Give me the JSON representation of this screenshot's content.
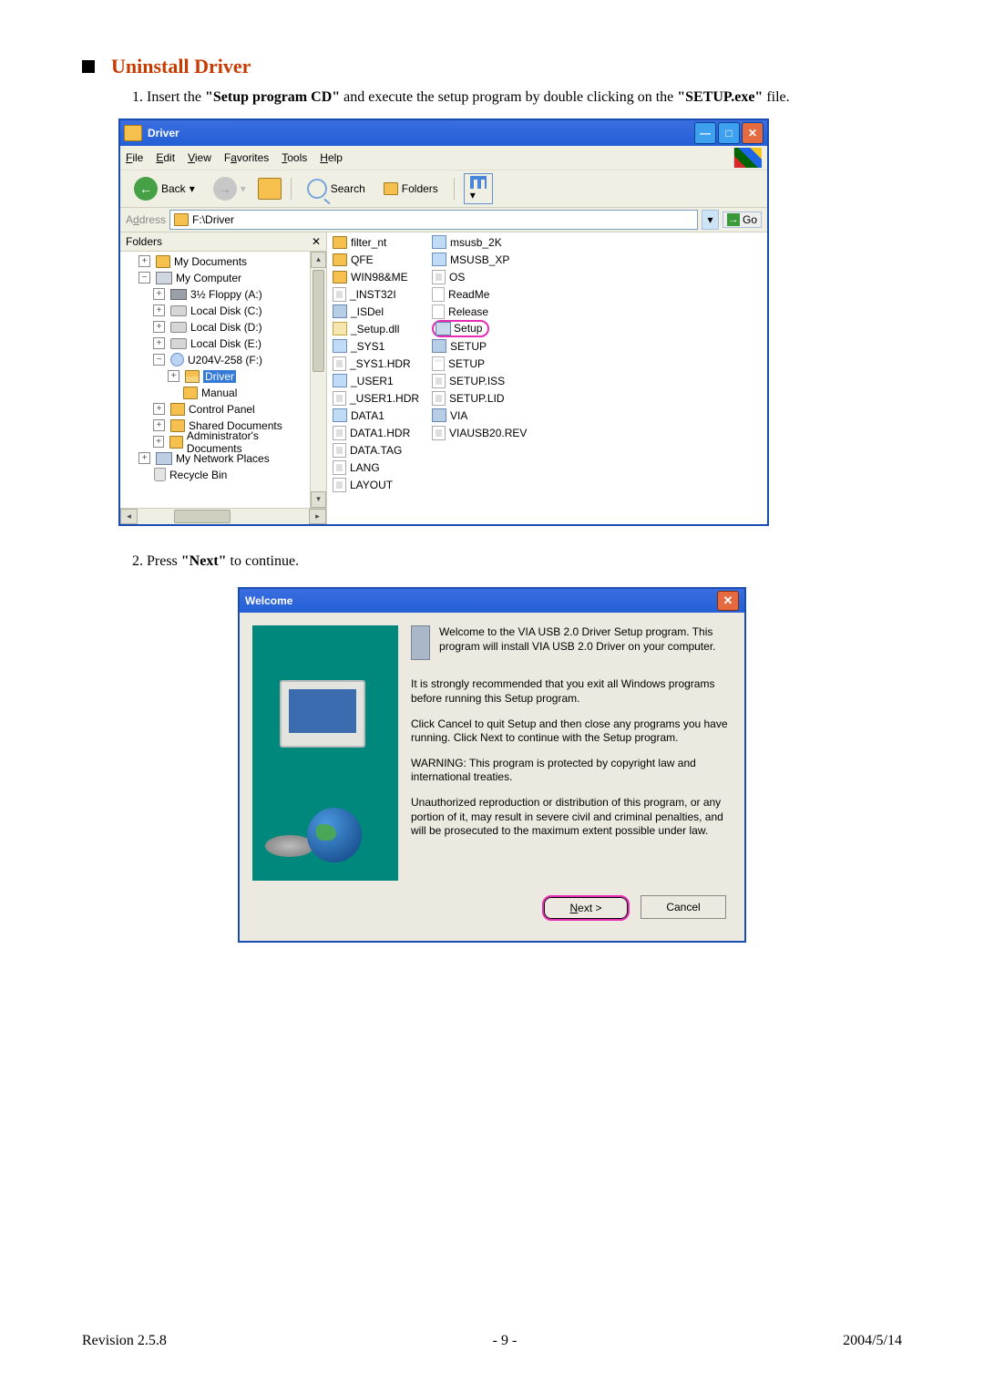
{
  "heading": "Uninstall Driver",
  "instruction1_prefix": "1. Insert the ",
  "instruction1_bold1": "\"Setup program CD\"",
  "instruction1_mid": " and execute the setup program by double clicking on the ",
  "instruction1_bold2": "\"SETUP.exe\"",
  "instruction1_suffix": " file.",
  "instruction2_prefix": "2. Press ",
  "instruction2_bold": "\"Next\"",
  "instruction2_suffix": " to continue.",
  "explorer": {
    "title": "Driver",
    "menu": {
      "file": "File",
      "edit": "Edit",
      "view": "View",
      "favorites": "Favorites",
      "tools": "Tools",
      "help": "Help"
    },
    "toolbar": {
      "back": "Back",
      "search": "Search",
      "folders": "Folders"
    },
    "address_label": "Address",
    "address_value": "F:\\Driver",
    "go": "Go",
    "folders_header": "Folders",
    "tree": {
      "my_documents": "My Documents",
      "my_computer": "My Computer",
      "floppy": "3½ Floppy (A:)",
      "cdrive": "Local Disk (C:)",
      "ddrive": "Local Disk (D:)",
      "edrive": "Local Disk (E:)",
      "udrive": "U204V-258 (F:)",
      "driver": "Driver",
      "manual": "Manual",
      "control_panel": "Control Panel",
      "shared_docs": "Shared Documents",
      "admin_docs": "Administrator's Documents",
      "netplaces": "My Network Places",
      "recycle": "Recycle Bin"
    },
    "files_col1": [
      "filter_nt",
      "QFE",
      "WIN98&ME",
      "_INST32I",
      "_ISDel",
      "_Setup.dll",
      "_SYS1",
      "_SYS1.HDR",
      "_USER1",
      "_USER1.HDR",
      "DATA1",
      "DATA1.HDR",
      "DATA.TAG",
      "LANG",
      "LAYOUT"
    ],
    "files_col2": [
      "msusb_2K",
      "MSUSB_XP",
      "OS",
      "ReadMe",
      "Release",
      "Setup",
      "SETUP",
      "SETUP",
      "SETUP.ISS",
      "SETUP.LID",
      "VIA",
      "VIAUSB20.REV"
    ]
  },
  "dialog": {
    "title": "Welcome",
    "p1": "Welcome to the VIA USB 2.0 Driver Setup program. This program will install VIA USB 2.0 Driver on your computer.",
    "p2": "It is strongly recommended that you exit all Windows programs before running this Setup program.",
    "p3": "Click Cancel to quit Setup and then close any programs you have running.  Click Next to continue with the Setup program.",
    "p4": "WARNING: This program is protected by copyright law and international treaties.",
    "p5": "Unauthorized reproduction or distribution of this program, or any portion of it, may result in severe civil and criminal penalties, and will be prosecuted to the maximum extent possible under law.",
    "next": "Next >",
    "cancel": "Cancel"
  },
  "footer": {
    "revision": "Revision 2.5.8",
    "page": "- 9 -",
    "date": "2004/5/14"
  }
}
